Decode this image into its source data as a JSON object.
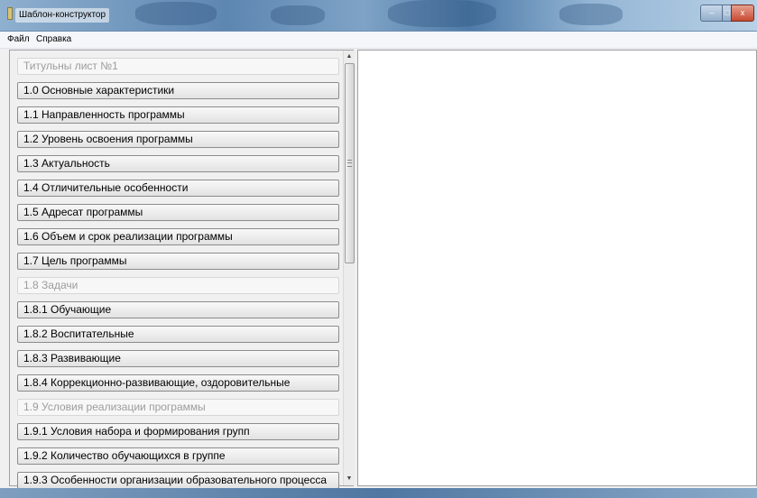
{
  "window": {
    "title": "Шаблон-конструктор",
    "controls": {
      "minimize": "–",
      "maximize": "□",
      "close": "x"
    }
  },
  "menu": {
    "file": "Файл",
    "help": "Справка"
  },
  "items": [
    {
      "label": "Титульны лист №1",
      "enabled": false
    },
    {
      "label": "1.0 Основные характеристики",
      "enabled": true
    },
    {
      "label": "1.1 Направленность программы",
      "enabled": true
    },
    {
      "label": "1.2 Уровень освоения программы",
      "enabled": true
    },
    {
      "label": "1.3 Актуальность",
      "enabled": true
    },
    {
      "label": "1.4 Отличительные особенности",
      "enabled": true
    },
    {
      "label": "1.5 Адресат программы",
      "enabled": true
    },
    {
      "label": "1.6 Объем и срок реализации программы",
      "enabled": true
    },
    {
      "label": "1.7 Цель программы",
      "enabled": true
    },
    {
      "label": "1.8 Задачи",
      "enabled": false
    },
    {
      "label": "1.8.1 Обучающие",
      "enabled": true
    },
    {
      "label": "1.8.2 Воспитательные",
      "enabled": true
    },
    {
      "label": "1.8.3 Развивающие",
      "enabled": true
    },
    {
      "label": "1.8.4 Коррекционно-развивающие, оздоровительные",
      "enabled": true
    },
    {
      "label": "1.9 Условия реализации программы",
      "enabled": false
    },
    {
      "label": "1.9.1 Условия набора и формирования групп",
      "enabled": true
    },
    {
      "label": "1.9.2 Количество обучающихся в группе",
      "enabled": true
    },
    {
      "label": "1.9.3 Особенности организации образовательного процесса",
      "enabled": true
    }
  ],
  "scroll": {
    "up_arrow": "▲",
    "down_arrow": "▼"
  }
}
